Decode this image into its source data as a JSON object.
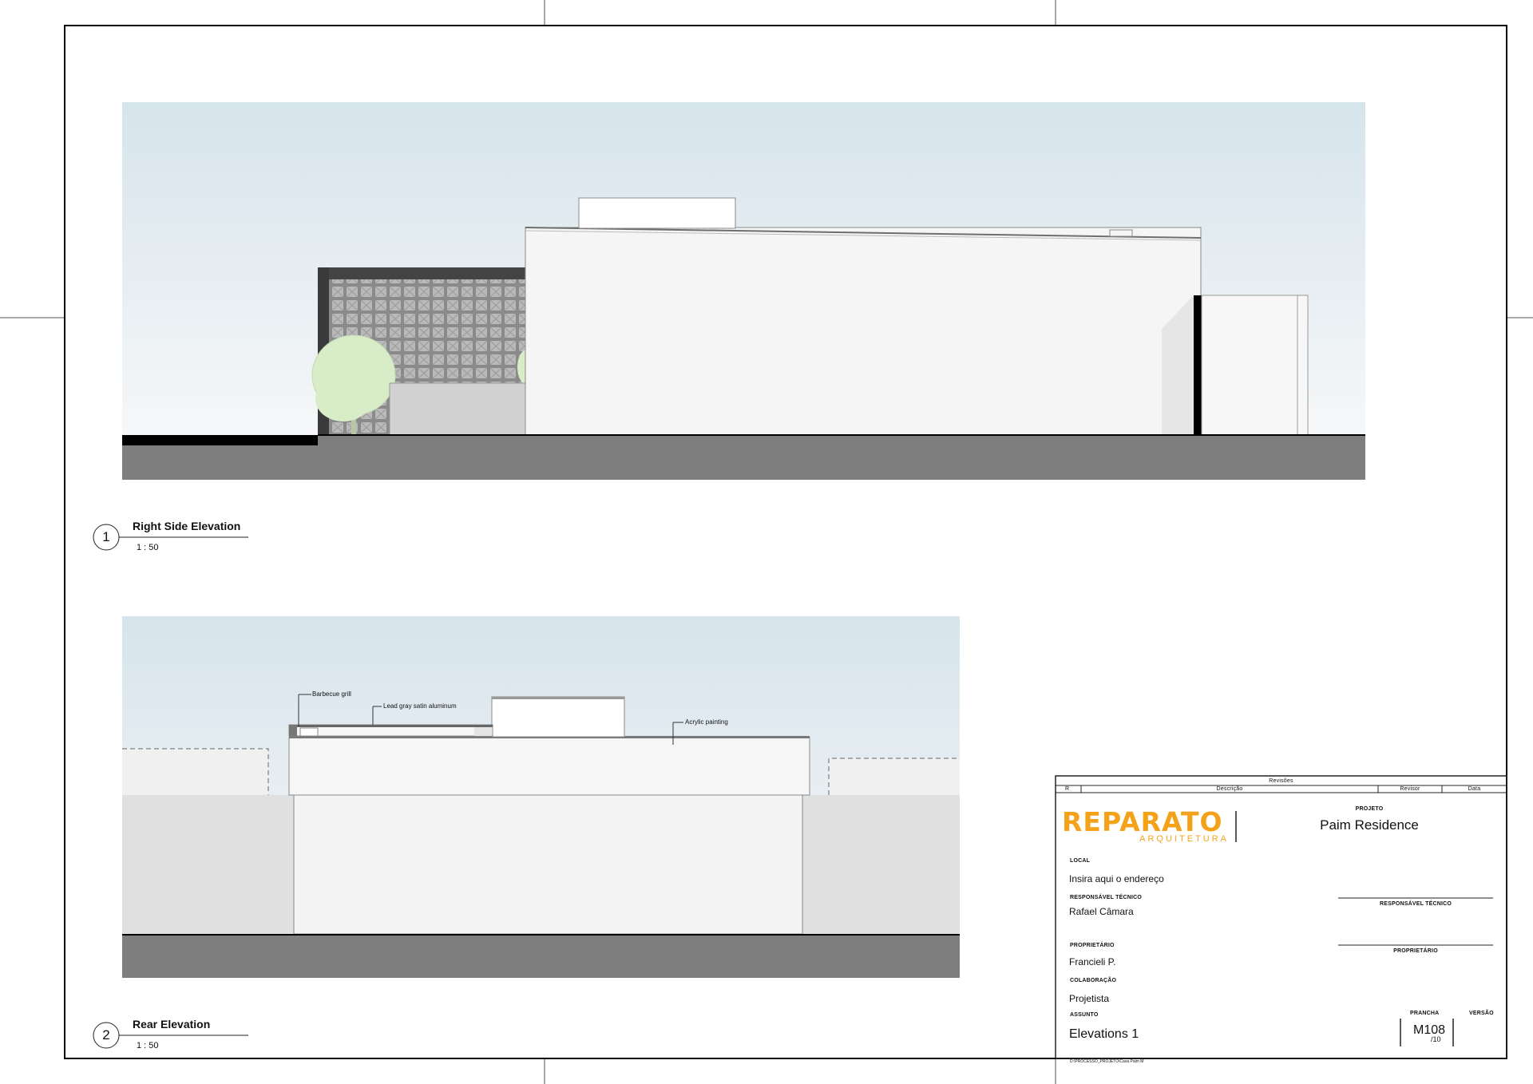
{
  "views": [
    {
      "number": "1",
      "title": "Right Side Elevation",
      "scale": "1 : 50"
    },
    {
      "number": "2",
      "title": "Rear Elevation",
      "scale": "1 : 50"
    }
  ],
  "annotations": {
    "barbecue": "Barbecue grill",
    "aluminum": "Lead gray satin aluminum",
    "acrylic": "Acrylic painting"
  },
  "title_block": {
    "revisions_header": "Revisões",
    "col_r": "R",
    "col_desc": "Descrição",
    "col_revisor": "Revisor",
    "col_data": "Data",
    "logo_main": "REPARATO",
    "logo_sub": "ARQUITETURA",
    "projeto_label": "PROJETO",
    "projeto_value": "Paim Residence",
    "local_label": "LOCAL",
    "local_value": "Insira aqui o endereço",
    "resp_label": "RESPONSÁVEL TÉCNICO",
    "resp_value": "Rafael Câmara",
    "resp_sign_label": "RESPONSÁVEL TÉCNICO",
    "prop_label": "PROPRIETÁRIO",
    "prop_value": "Francieli P.",
    "prop_sign_label": "PROPRIETÁRIO",
    "colab_label": "COLABORAÇÃO",
    "colab_value": "Projetista",
    "assunto_label": "ASSUNTO",
    "assunto_value": "Elevations 1",
    "prancha_label": "PRANCHA",
    "versao_label": "VERSÃO",
    "sheet_number": "M108",
    "sheet_total": "/10",
    "file_path": "D:\\PROCESSO_PROJETO\\Casa Paim M"
  },
  "colors": {
    "brand_orange": "#f5a21b",
    "sky_top": "#d6e4ec",
    "ground": "#7e7e7e",
    "tree": "#d9ecc8"
  }
}
